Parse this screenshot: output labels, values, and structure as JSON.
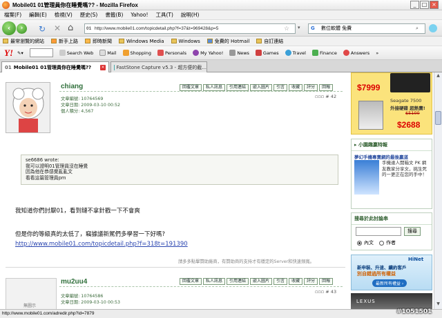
{
  "window": {
    "title": "Mobile01 01管理員你在睡覺嗎?? - Mozilla Firefox"
  },
  "menu": [
    "檔案(F)",
    "編輯(E)",
    "檢視(V)",
    "歷史(S)",
    "書籤(B)",
    "Yahoo!",
    "工具(T)",
    "說明(H)"
  ],
  "nav": {
    "url": "http://www.mobile01.com/topicdetail.php?f=37&t=969428&p=5",
    "search_value": "數位軟體 免費"
  },
  "bookmarks": [
    "最常瀏覽的網站",
    "新手上路",
    "即時新聞",
    "Windows Media",
    "Windows",
    "免費的 Hotmail",
    "自訂連結"
  ],
  "yahoo_toolbar": {
    "logo": "Y!",
    "items": [
      "Search Web",
      "Mail",
      "Shopping",
      "Personals",
      "My Yahoo!",
      "News",
      "Games",
      "Travel",
      "Finance",
      "Answers"
    ]
  },
  "tabs": [
    {
      "label": "Mobile01 01管理員你在睡覺嗎??",
      "active": true
    },
    {
      "label": "FastStone Capture v5.3 - 超方便的截...",
      "active": false
    }
  ],
  "post_buttons": [
    "回覆文章",
    "私人訊息",
    "引用連結",
    "嵌入圖片",
    "引言",
    "收藏",
    "評分",
    "回報"
  ],
  "post1": {
    "username": "chiang",
    "info": [
      "文章編號: 10764569",
      "文章日期: 2009-03-10 00:52",
      "個人積分: 4,567"
    ],
    "floor": "# 42",
    "quote_header": "se6686 wrote:",
    "quote_lines": [
      "我可以證明01管理員沒在睡覺",
      "因為他在恭感覺亂亂文",
      "看看這篇管理員pm"
    ],
    "body1": "我知道你們討厭01，看到鏈不拿針戳一下不會爽",
    "body2": "但是你的等級真的太低了，竊據議新駕們多學習一下好嗎?",
    "link": "http://www.mobile01.com/topicdetail.php?f=318t=191390",
    "footer_note": "請多多點擊贊助廠商，有贊助商的支持才有穩定的Server和快速頻寬。"
  },
  "post2": {
    "username": "mu2uu4",
    "info": [
      "文章編號: 10764586",
      "文章日期: 2009-03-10 00:53"
    ],
    "floor": "# 43",
    "avatar_text": "無圖示"
  },
  "sidebar": {
    "ad1_price1": "$7999",
    "ad1_model": "Seagate 7500",
    "ad1_sub": "外接硬碟 超熱賣!",
    "ad1_old": "$5100",
    "ad1_price2": "$2688",
    "widget1_title": "小園趣贏特報",
    "widget1_sub": "夢幻手機專賣網的最後贏道",
    "widget1_text": "手機達人開箱文 PK 網友教家分享文，挑生死的一更正在您的手中！",
    "widget2_title": "搜尋於此討論串",
    "search_button": "搜尋",
    "radio1": "內文",
    "radio2": "作者",
    "ad2_brand": "HiNet",
    "ad2_line1": "新申裝、升速、續約客戶",
    "ad2_line2": "別自錯過所有權益",
    "ad2_btn": "最新所有權益 ›",
    "ad3_brand": "LEXUS"
  },
  "status": "http://www.mobile01.com/adredir.php?id=7879",
  "watermark": "#1051501"
}
